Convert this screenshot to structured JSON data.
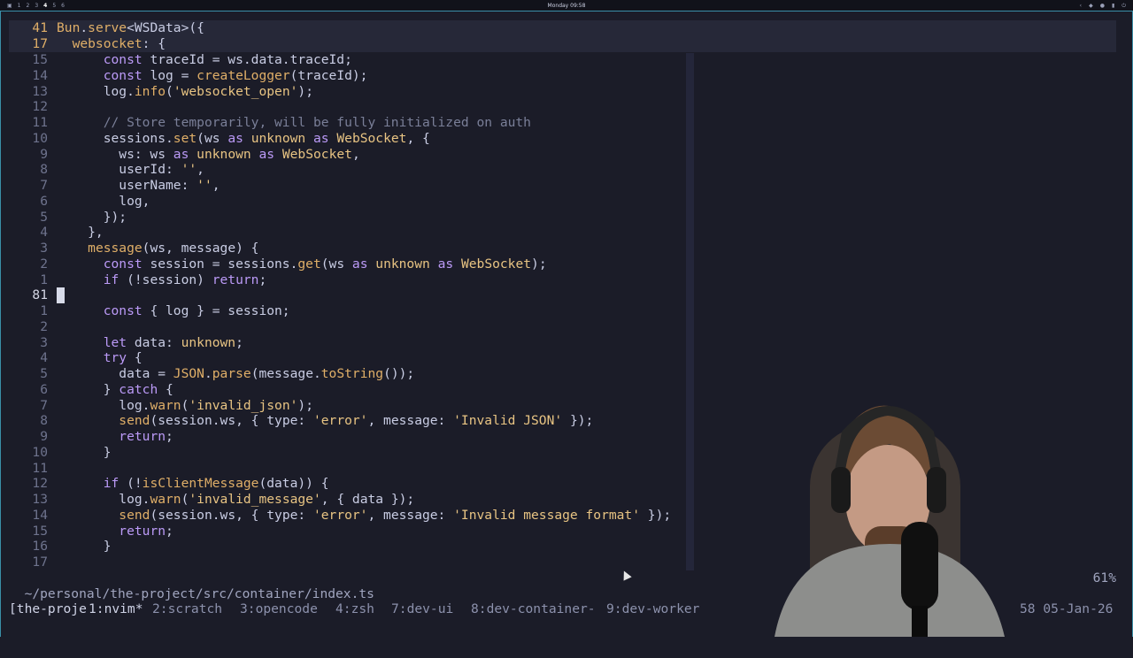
{
  "topbar": {
    "workspaces": [
      "1",
      "2",
      "3",
      "4",
      "5",
      "6"
    ],
    "active_workspace_index": 3,
    "clock": "Monday 09:58"
  },
  "editor": {
    "sticky": [
      {
        "num": "41",
        "tokens": [
          [
            "f",
            "Bun"
          ],
          [
            "p",
            "."
          ],
          [
            "f",
            "serve"
          ],
          [
            "p",
            "<WSData>({"
          ]
        ]
      },
      {
        "num": "17",
        "tokens": [
          [
            "p",
            "  "
          ],
          [
            "f",
            "websocket"
          ],
          [
            "p",
            ": {"
          ]
        ]
      }
    ],
    "lines": [
      {
        "num": "15",
        "tokens": [
          [
            "p",
            "      "
          ],
          [
            "k",
            "const"
          ],
          [
            "p",
            " traceId = ws.data.traceId;"
          ]
        ]
      },
      {
        "num": "14",
        "tokens": [
          [
            "p",
            "      "
          ],
          [
            "k",
            "const"
          ],
          [
            "p",
            " log = "
          ],
          [
            "f",
            "createLogger"
          ],
          [
            "p",
            "(traceId);"
          ]
        ]
      },
      {
        "num": "13",
        "tokens": [
          [
            "p",
            "      log."
          ],
          [
            "f",
            "info"
          ],
          [
            "p",
            "("
          ],
          [
            "s",
            "'websocket_open'"
          ],
          [
            "p",
            ");"
          ]
        ]
      },
      {
        "num": "12",
        "tokens": [
          [
            "p",
            ""
          ]
        ]
      },
      {
        "num": "11",
        "tokens": [
          [
            "p",
            "      "
          ],
          [
            "c",
            "// Store temporarily, will be fully initialized on auth"
          ]
        ]
      },
      {
        "num": "10",
        "tokens": [
          [
            "p",
            "      sessions."
          ],
          [
            "f",
            "set"
          ],
          [
            "p",
            "(ws "
          ],
          [
            "k",
            "as"
          ],
          [
            "p",
            " "
          ],
          [
            "t",
            "unknown"
          ],
          [
            "p",
            " "
          ],
          [
            "k",
            "as"
          ],
          [
            "p",
            " "
          ],
          [
            "t",
            "WebSocket"
          ],
          [
            "p",
            ", {"
          ]
        ]
      },
      {
        "num": "9",
        "tokens": [
          [
            "p",
            "        ws: ws "
          ],
          [
            "k",
            "as"
          ],
          [
            "p",
            " "
          ],
          [
            "t",
            "unknown"
          ],
          [
            "p",
            " "
          ],
          [
            "k",
            "as"
          ],
          [
            "p",
            " "
          ],
          [
            "t",
            "WebSocket"
          ],
          [
            "p",
            ","
          ]
        ]
      },
      {
        "num": "8",
        "tokens": [
          [
            "p",
            "        userId: "
          ],
          [
            "s",
            "''"
          ],
          [
            "p",
            ","
          ]
        ]
      },
      {
        "num": "7",
        "tokens": [
          [
            "p",
            "        userName: "
          ],
          [
            "s",
            "''"
          ],
          [
            "p",
            ","
          ]
        ]
      },
      {
        "num": "6",
        "tokens": [
          [
            "p",
            "        log,"
          ]
        ]
      },
      {
        "num": "5",
        "tokens": [
          [
            "p",
            "      });"
          ]
        ]
      },
      {
        "num": "4",
        "tokens": [
          [
            "p",
            "    },"
          ]
        ]
      },
      {
        "num": "3",
        "tokens": [
          [
            "p",
            "    "
          ],
          [
            "f",
            "message"
          ],
          [
            "p",
            "(ws, message) {"
          ]
        ]
      },
      {
        "num": "2",
        "tokens": [
          [
            "p",
            "      "
          ],
          [
            "k",
            "const"
          ],
          [
            "p",
            " session = sessions."
          ],
          [
            "f",
            "get"
          ],
          [
            "p",
            "(ws "
          ],
          [
            "k",
            "as"
          ],
          [
            "p",
            " "
          ],
          [
            "t",
            "unknown"
          ],
          [
            "p",
            " "
          ],
          [
            "k",
            "as"
          ],
          [
            "p",
            " "
          ],
          [
            "t",
            "WebSocket"
          ],
          [
            "p",
            ");"
          ]
        ]
      },
      {
        "num": "1",
        "tokens": [
          [
            "p",
            "      "
          ],
          [
            "k",
            "if"
          ],
          [
            "p",
            " (!session) "
          ],
          [
            "k",
            "return"
          ],
          [
            "p",
            ";"
          ]
        ]
      },
      {
        "num": "81",
        "cur": true,
        "tokens": [
          [
            "p",
            ""
          ]
        ]
      },
      {
        "num": "1",
        "tokens": [
          [
            "p",
            "      "
          ],
          [
            "k",
            "const"
          ],
          [
            "p",
            " { log } = session;"
          ]
        ]
      },
      {
        "num": "2",
        "tokens": [
          [
            "p",
            ""
          ]
        ]
      },
      {
        "num": "3",
        "tokens": [
          [
            "p",
            "      "
          ],
          [
            "k",
            "let"
          ],
          [
            "p",
            " data: "
          ],
          [
            "t",
            "unknown"
          ],
          [
            "p",
            ";"
          ]
        ]
      },
      {
        "num": "4",
        "tokens": [
          [
            "p",
            "      "
          ],
          [
            "k",
            "try"
          ],
          [
            "p",
            " {"
          ]
        ]
      },
      {
        "num": "5",
        "tokens": [
          [
            "p",
            "        data = "
          ],
          [
            "f",
            "JSON"
          ],
          [
            "p",
            "."
          ],
          [
            "f",
            "parse"
          ],
          [
            "p",
            "(message."
          ],
          [
            "f",
            "toString"
          ],
          [
            "p",
            "());"
          ]
        ]
      },
      {
        "num": "6",
        "tokens": [
          [
            "p",
            "      } "
          ],
          [
            "k",
            "catch"
          ],
          [
            "p",
            " {"
          ]
        ]
      },
      {
        "num": "7",
        "tokens": [
          [
            "p",
            "        log."
          ],
          [
            "f",
            "warn"
          ],
          [
            "p",
            "("
          ],
          [
            "s",
            "'invalid_json'"
          ],
          [
            "p",
            ");"
          ]
        ]
      },
      {
        "num": "8",
        "tokens": [
          [
            "p",
            "        "
          ],
          [
            "f",
            "send"
          ],
          [
            "p",
            "(session.ws, { type: "
          ],
          [
            "s",
            "'error'"
          ],
          [
            "p",
            ", message: "
          ],
          [
            "s",
            "'Invalid JSON'"
          ],
          [
            "p",
            " });"
          ]
        ]
      },
      {
        "num": "9",
        "tokens": [
          [
            "p",
            "        "
          ],
          [
            "k",
            "return"
          ],
          [
            "p",
            ";"
          ]
        ]
      },
      {
        "num": "10",
        "tokens": [
          [
            "p",
            "      }"
          ]
        ]
      },
      {
        "num": "11",
        "tokens": [
          [
            "p",
            ""
          ]
        ]
      },
      {
        "num": "12",
        "tokens": [
          [
            "p",
            "      "
          ],
          [
            "k",
            "if"
          ],
          [
            "p",
            " (!"
          ],
          [
            "f",
            "isClientMessage"
          ],
          [
            "p",
            "(data)) {"
          ]
        ]
      },
      {
        "num": "13",
        "tokens": [
          [
            "p",
            "        log."
          ],
          [
            "f",
            "warn"
          ],
          [
            "p",
            "("
          ],
          [
            "s",
            "'invalid_message'"
          ],
          [
            "p",
            ", { data });"
          ]
        ]
      },
      {
        "num": "14",
        "tokens": [
          [
            "p",
            "        "
          ],
          [
            "f",
            "send"
          ],
          [
            "p",
            "(session.ws, { type: "
          ],
          [
            "s",
            "'error'"
          ],
          [
            "p",
            ", message: "
          ],
          [
            "s",
            "'Invalid message format'"
          ],
          [
            "p",
            " });"
          ]
        ]
      },
      {
        "num": "15",
        "tokens": [
          [
            "p",
            "        "
          ],
          [
            "k",
            "return"
          ],
          [
            "p",
            ";"
          ]
        ]
      },
      {
        "num": "16",
        "tokens": [
          [
            "p",
            "      }"
          ]
        ]
      },
      {
        "num": "17",
        "tokens": [
          [
            "p",
            ""
          ]
        ]
      }
    ]
  },
  "statusline": {
    "path": "~/personal/the-project/src/container/index.ts",
    "percent": "61%"
  },
  "tmux": {
    "session": "[the-proje",
    "windows": [
      "1:nvim*",
      "2:scratch",
      "3:opencode",
      "4:zsh",
      "7:dev-ui",
      "8:dev-container-",
      "9:dev-worker"
    ],
    "right": "58 05-Jan-26"
  }
}
